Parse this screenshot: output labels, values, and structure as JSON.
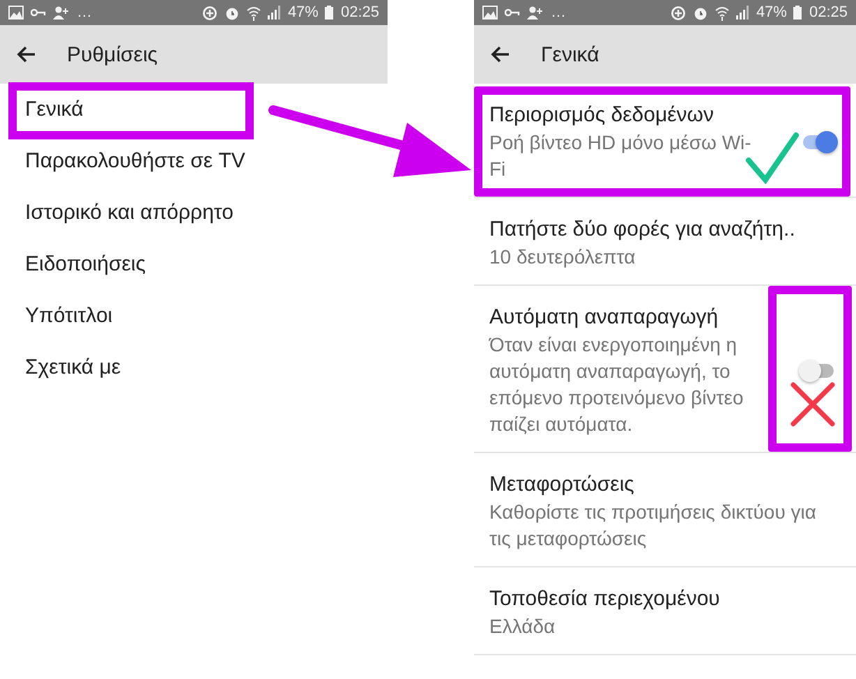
{
  "left": {
    "status_bar": {
      "more": "…",
      "battery": "47%",
      "time": "02:25"
    },
    "title": "Ρυθμίσεις",
    "items": [
      {
        "label": "Γενικά",
        "highlighted": true
      },
      {
        "label": "Παρακολουθήστε σε TV",
        "highlighted": false
      },
      {
        "label": "Ιστορικό και απόρρητο",
        "highlighted": false
      },
      {
        "label": "Ειδοποιήσεις",
        "highlighted": false
      },
      {
        "label": "Υπότιτλοι",
        "highlighted": false
      },
      {
        "label": "Σχετικά με",
        "highlighted": false
      }
    ]
  },
  "right": {
    "status_bar": {
      "more": "…",
      "battery": "47%",
      "time": "02:25"
    },
    "title": "Γενικά",
    "settings": [
      {
        "kind": "toggle",
        "title": "Περιορισμός δεδομένων",
        "subtitle": "Ροή βίντεο HD μόνο μέσω Wi-Fi",
        "on": true,
        "highlighted": true,
        "approved": true
      },
      {
        "kind": "text",
        "title": "Πατήστε δύο φορές για αναζήτη..",
        "subtitle": "10 δευτερόλεπτα",
        "highlighted": false
      },
      {
        "kind": "toggle",
        "title": "Αυτόματη αναπαραγωγή",
        "subtitle": "Όταν είναι ενεργοποιημένη η αυτόματη αναπαραγωγή, το επόμενο προτεινόμενο βίντεο παίζει αυτόματα.",
        "on": false,
        "highlighted": true,
        "approved": false
      },
      {
        "kind": "text",
        "title": "Μεταφορτώσεις",
        "subtitle": "Καθορίστε τις προτιμήσεις δικτύου για τις μεταφορτώσεις",
        "highlighted": false
      },
      {
        "kind": "text",
        "title": "Τοποθεσία περιεχομένου",
        "subtitle": "Ελλάδα",
        "highlighted": false
      }
    ]
  }
}
